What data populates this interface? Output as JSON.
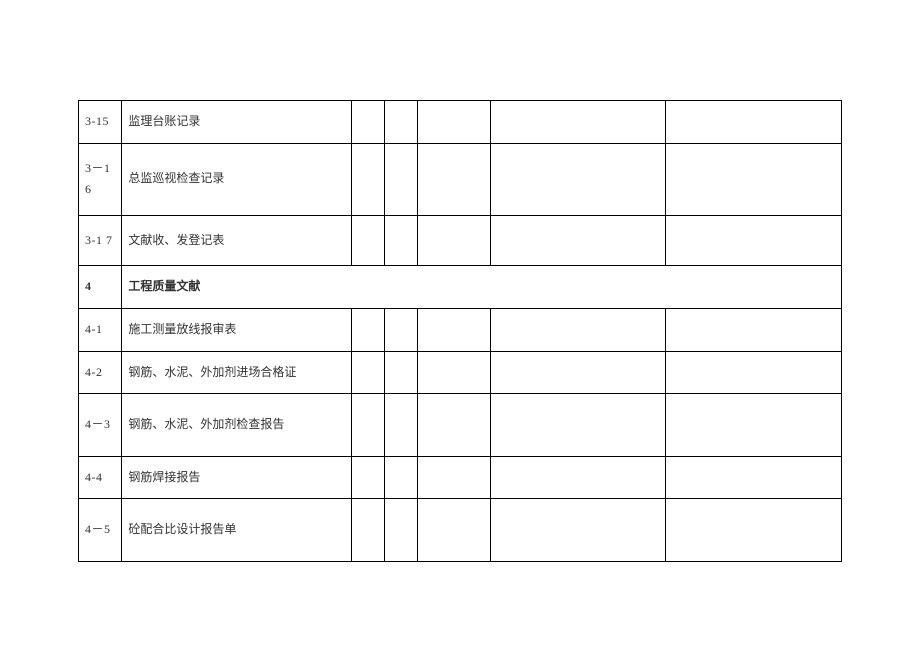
{
  "rows": [
    {
      "id": "3-15",
      "desc": "监理台账记录",
      "type": "item"
    },
    {
      "id": "3－1 6",
      "desc": "总监巡视检查记录",
      "type": "item-tall"
    },
    {
      "id": "3-1 7",
      "desc": "文献收、发登记表",
      "type": "item-tall"
    },
    {
      "id": "4",
      "desc": "工程质量文献",
      "type": "section"
    },
    {
      "id": "4-1",
      "desc": "施工测量放线报审表",
      "type": "item"
    },
    {
      "id": "4-2",
      "desc": "钢筋、水泥、外加剂进场合格证",
      "type": "item"
    },
    {
      "id": "4－3",
      "desc": "钢筋、水泥、外加剂检查报告",
      "type": "item-taller"
    },
    {
      "id": "4-4",
      "desc": "钢筋焊接报告",
      "type": "item"
    },
    {
      "id": "4－5",
      "desc": "砼配合比设计报告单",
      "type": "item-taller"
    }
  ]
}
